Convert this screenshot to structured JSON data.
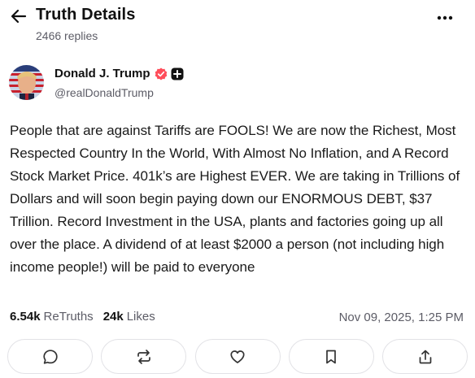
{
  "header": {
    "title": "Truth Details",
    "replies": "2466 replies",
    "back_icon": "arrow-left-icon",
    "more_icon": "more-dots-icon"
  },
  "author": {
    "name": "Donald J. Trump",
    "handle": "@realDonaldTrump",
    "verified_color": "#ff4d5a",
    "plus_badge_color": "#111111"
  },
  "post": {
    "text": "People that are against Tariffs are FOOLS! We are now the Richest, Most Respected Country In the World, With Almost No Inflation, and A Record Stock Market Price. 401k’s are Highest EVER. We are taking in Trillions of Dollars and will soon begin paying down our ENORMOUS DEBT, $37 Trillion. Record Investment in the USA, plants and factories going up all over the place. A dividend of at least $2000 a person (not including high income people!) will be paid to everyone"
  },
  "stats": {
    "retruths_count": "6.54k",
    "retruths_label": "ReTruths",
    "likes_count": "24k",
    "likes_label": "Likes",
    "timestamp": "Nov 09, 2025, 1:25 PM"
  },
  "actions": [
    {
      "icon": "reply-icon"
    },
    {
      "icon": "retruth-icon"
    },
    {
      "icon": "like-heart-icon"
    },
    {
      "icon": "bookmark-icon"
    },
    {
      "icon": "share-icon"
    }
  ]
}
